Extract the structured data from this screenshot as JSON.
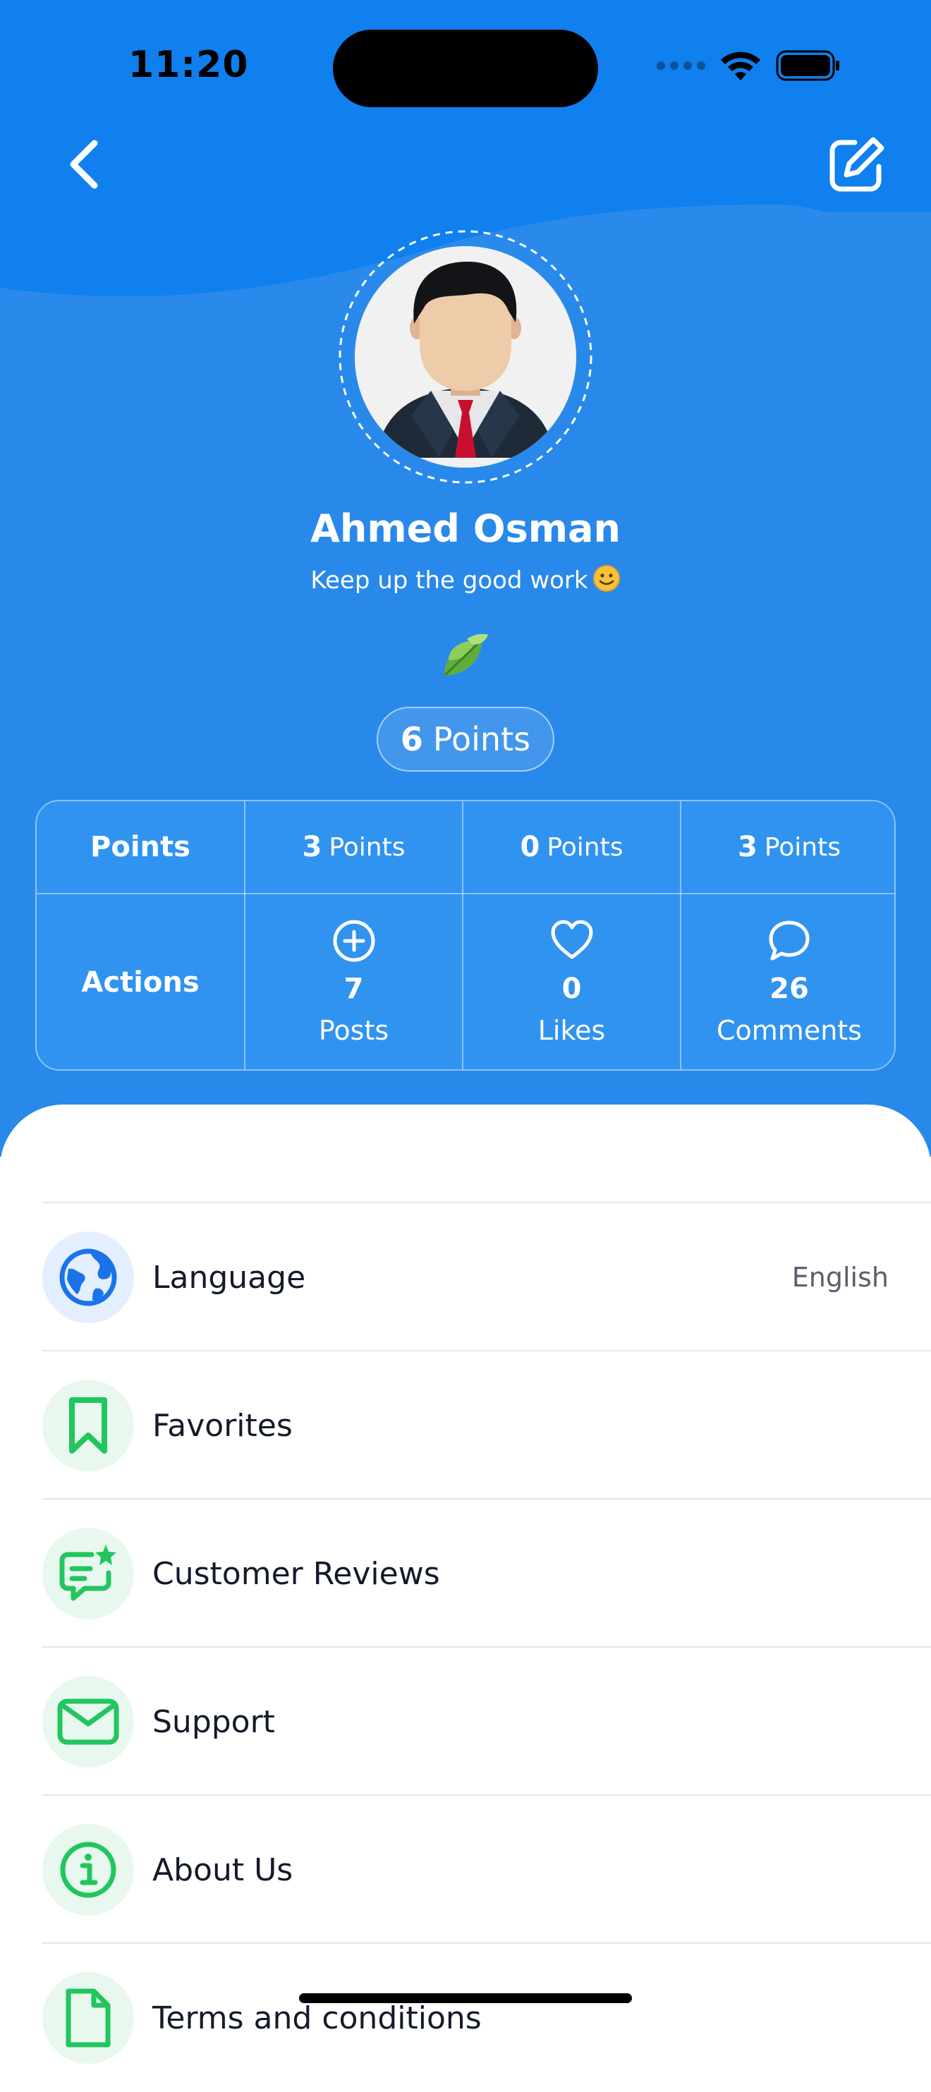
{
  "status_bar": {
    "time": "11:20"
  },
  "profile": {
    "name": "Ahmed Osman",
    "subtitle": "Keep up the good work",
    "total_points_value": "6",
    "total_points_unit": "Points"
  },
  "stats": {
    "points_row_label": "Points",
    "actions_row_label": "Actions",
    "columns": [
      {
        "points": "3",
        "points_unit": "Points",
        "count": "7",
        "label": "Posts",
        "icon": "plus-circle-icon"
      },
      {
        "points": "0",
        "points_unit": "Points",
        "count": "0",
        "label": "Likes",
        "icon": "heart-icon"
      },
      {
        "points": "3",
        "points_unit": "Points",
        "count": "26",
        "label": "Comments",
        "icon": "comment-icon"
      }
    ]
  },
  "menu": [
    {
      "label": "Language",
      "value": "English",
      "icon": "globe-icon"
    },
    {
      "label": "Favorites",
      "icon": "bookmark-icon"
    },
    {
      "label": "Customer Reviews",
      "icon": "review-icon"
    },
    {
      "label": "Support",
      "icon": "mail-icon"
    },
    {
      "label": "About Us",
      "icon": "info-icon"
    },
    {
      "label": "Terms and conditions",
      "icon": "document-icon"
    }
  ],
  "colors": {
    "header_blue": "#0f80ee",
    "profile_blue": "#2889eb",
    "accent_green": "#22c55e",
    "globe_blue": "#1a73e8"
  }
}
